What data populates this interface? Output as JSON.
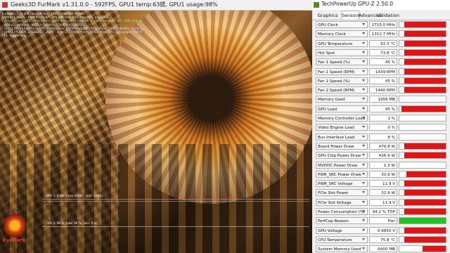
{
  "colors": {
    "bar_red": "#e01414",
    "bar_green": "#22c422",
    "fm_accent": "#e23a1a"
  },
  "furmark": {
    "title": "Geeks3D FurMark v1.31.0.0 - 592FPS, GPU1 temp:63掳, GPU1 usage:98%",
    "overlay": {
      "line1": "FurMark v1.31.0.0 - Burn-in test, 1920x1080 (8X MSAA)",
      "line2": "Frames:138216 - time:00:00:37 - FPS:592 (min:517, max:611, avg:589)",
      "line3": "[ GPU-Z ] core: 2715 MHz - mem: 1313 MHz - GPU load: 98 % - GPU temp: 63 掳C - GPU chip power: 471.0 W (PPW: 1.256) - Board power: 471.0 W (PPW: 1.256) - GPU voltage: 0.995 V",
      "line4": "- OpenGL renderer: NVIDIA GeForce RTX 4090/PCIe/SSE2",
      "line5": "- GPU 1 (NVIDIA GeForce RTX 4090) - core: 2715MHz/63掳C/98%, mem: 10501MHz/8%, limits:[power:1, temp:0, volt:0, OV:0]",
      "line6": "- GPU 2 (PCIVEN_10DE&DEV_2684) - core: 2715MHz, mem: 10501MHz, GPU chip power: 436.9 W (PPW: 1.355)",
      "line7": "- F1: toggle help"
    },
    "graph1_label": "GPU 1: 63掳C (max: 63掳C - min: 26掳C)",
    "graph2_label": "GPU 1: 98 % (max: 99 % - min: 0 %)",
    "logo_text": "FurMark"
  },
  "gpuz": {
    "title": "TechPowerUp GPU-Z 2.50.0",
    "tabs": [
      {
        "label": "Graphics Card"
      },
      {
        "label": "Sensors"
      },
      {
        "label": "Advanced"
      },
      {
        "label": "Validation"
      }
    ],
    "sensors": [
      {
        "label": "GPU Clock",
        "value": "2715.0 MHz",
        "fill": 0.9,
        "color": "red"
      },
      {
        "label": "Memory Clock",
        "value": "1312.7 MHz",
        "fill": 0.9,
        "color": "red"
      },
      {
        "label": "GPU Temperature",
        "value": "63.3 °C",
        "fill": 0.9,
        "color": "red"
      },
      {
        "label": "Hot Spot",
        "value": "73.8 °C",
        "fill": 0.9,
        "color": "red"
      },
      {
        "label": "Fan 1 Speed (%)",
        "value": "45 %",
        "fill": 0.9,
        "color": "red"
      },
      {
        "label": "Fan 1 Speed (RPM)",
        "value": "1439 RPM",
        "fill": 0.9,
        "color": "red"
      },
      {
        "label": "Fan 2 Speed (%)",
        "value": "45 %",
        "fill": 0.9,
        "color": "red"
      },
      {
        "label": "Fan 2 Speed (RPM)",
        "value": "1440 RPM",
        "fill": 0.9,
        "color": "red"
      },
      {
        "label": "Memory Used",
        "value": "1958 MB",
        "fill": 0.0,
        "color": "red"
      },
      {
        "label": "GPU Load",
        "value": "95 %",
        "fill": 0.95,
        "color": "red"
      },
      {
        "label": "Memory Controller Load",
        "value": "1 %",
        "fill": 0.0,
        "color": "red"
      },
      {
        "label": "Video Engine Load",
        "value": "0 %",
        "fill": 0.0,
        "color": "red"
      },
      {
        "label": "Bus Interface Load",
        "value": "8 %",
        "fill": 0.0,
        "color": "red"
      },
      {
        "label": "Board Power Draw",
        "value": "470.8 W",
        "fill": 0.9,
        "color": "red"
      },
      {
        "label": "GPU Chip Power Draw",
        "value": "436.9 W",
        "fill": 0.9,
        "color": "red"
      },
      {
        "label": "MVDDC Power Draw",
        "value": "1.3 W",
        "fill": 0.0,
        "color": "red"
      },
      {
        "label": "PWR_SRC Power Draw",
        "value": "33.9 W",
        "fill": 0.85,
        "color": "red"
      },
      {
        "label": "PWR_SRC Voltage",
        "value": "11.9 V",
        "fill": 0.9,
        "color": "red"
      },
      {
        "label": "PCIe Slot Power",
        "value": "32.9 W",
        "fill": 0.9,
        "color": "red"
      },
      {
        "label": "PCIe Slot Voltage",
        "value": "11.9 V",
        "fill": 0.9,
        "color": "red"
      },
      {
        "label": "Power Consumption (%)",
        "value": "94.2 % TDP",
        "fill": 0.9,
        "color": "red"
      },
      {
        "label": "PerfCap Reason",
        "value": "Pwr",
        "fill": 1.0,
        "color": "green"
      },
      {
        "label": "GPU Voltage",
        "value": "0.9950 V",
        "fill": 0.9,
        "color": "red"
      },
      {
        "label": "CPU Temperature",
        "value": "75.8 °C",
        "fill": 0.9,
        "color": "red"
      },
      {
        "label": "System Memory Used",
        "value": "6400 MB",
        "fill": 0.5,
        "color": "red"
      }
    ]
  }
}
